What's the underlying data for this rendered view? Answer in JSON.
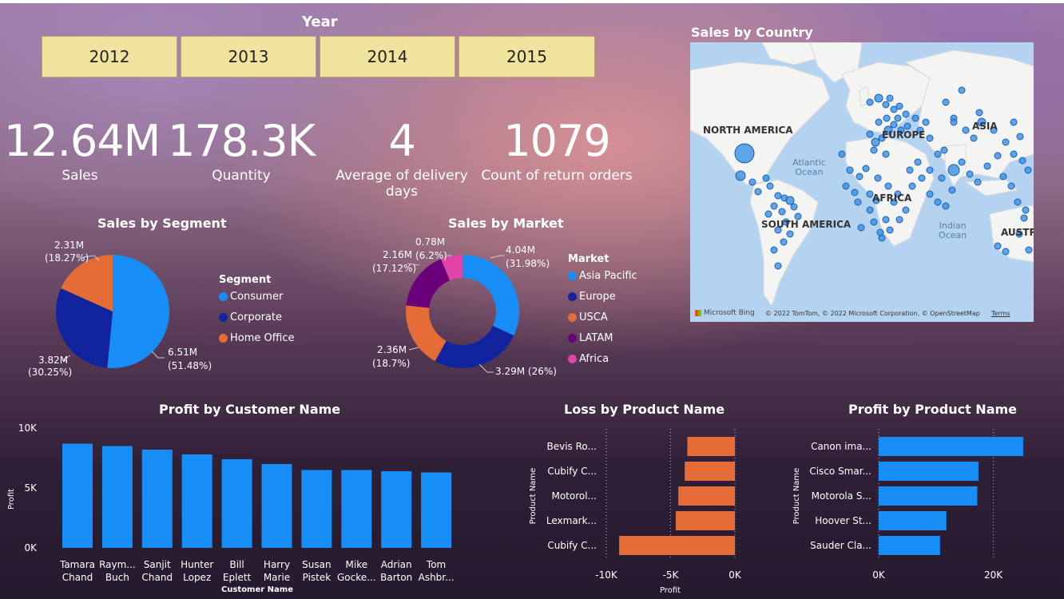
{
  "year_slicer": {
    "title": "Year",
    "options": [
      "2012",
      "2013",
      "2014",
      "2015"
    ]
  },
  "kpis": [
    {
      "value": "12.64M",
      "label": "Sales"
    },
    {
      "value": "178.3K",
      "label": "Quantity"
    },
    {
      "value": "4",
      "label": "Average of delivery days"
    },
    {
      "value": "1079",
      "label": "Count of return orders"
    }
  ],
  "map": {
    "title": "Sales by Country",
    "labels": {
      "north_america": "NORTH AMERICA",
      "europe": "EUROPE",
      "asia": "ASIA",
      "africa": "AFRICA",
      "south_america": "SOUTH AMERICA",
      "australia": "AUSTRA",
      "atlantic": "Atlantic\nOcean",
      "indian": "Indian\nOcean"
    },
    "logo": "Microsoft Bing",
    "copyright": "© 2022 TomTom, © 2022 Microsoft Corporation, © OpenStreetMap",
    "terms": "Terms"
  },
  "colors": {
    "blue": "#168ef5",
    "navy": "#12239e",
    "orange": "#e66c37",
    "purple": "#6b007b",
    "pink": "#e044a7",
    "slicer_bg": "#f0e39e"
  },
  "chart_data": [
    {
      "type": "pie",
      "title": "Sales by Segment",
      "legend_title": "Segment",
      "categories": [
        "Consumer",
        "Corporate",
        "Home Office"
      ],
      "values": [
        6.51,
        3.82,
        2.31
      ],
      "data_labels": [
        {
          "value": "6.51M",
          "pct": "(51.48%)"
        },
        {
          "value": "3.82M",
          "pct": "(30.25%)"
        },
        {
          "value": "2.31M",
          "pct": "(18.27%)"
        }
      ],
      "colors": [
        "#168ef5",
        "#12239e",
        "#e66c37"
      ],
      "legend_position": "right"
    },
    {
      "type": "donut",
      "title": "Sales by Market",
      "legend_title": "Market",
      "categories": [
        "Asia Pacific",
        "Europe",
        "USCA",
        "LATAM",
        "Africa"
      ],
      "values": [
        4.04,
        3.29,
        2.36,
        2.16,
        0.78
      ],
      "data_labels": [
        {
          "value": "4.04M",
          "pct": "(31.98%)"
        },
        {
          "value": "3.29M",
          "pct": "(26%)"
        },
        {
          "value": "2.36M",
          "pct": "(18.7%)"
        },
        {
          "value": "2.16M",
          "pct": "(17.12%)"
        },
        {
          "value": "0.78M",
          "pct": "(6.2%)"
        }
      ],
      "colors": [
        "#168ef5",
        "#12239e",
        "#e66c37",
        "#6b007b",
        "#e044a7"
      ],
      "legend_position": "right"
    },
    {
      "type": "bar",
      "title": "Profit by Customer Name",
      "xlabel": "Customer Name",
      "ylabel": "Profit",
      "categories": [
        [
          "Tamara",
          "Chand"
        ],
        [
          "Raym...",
          "Buch"
        ],
        [
          "Sanjit",
          "Chand"
        ],
        [
          "Hunter",
          "Lopez"
        ],
        [
          "Bill",
          "Eplett"
        ],
        [
          "Harry",
          "Marie"
        ],
        [
          "Susan",
          "Pistek"
        ],
        [
          "Mike",
          "Gocke..."
        ],
        [
          "Adrian",
          "Barton"
        ],
        [
          "Tom",
          "Ashbr..."
        ]
      ],
      "values": [
        8700,
        8500,
        8200,
        7800,
        7400,
        7000,
        6500,
        6500,
        6400,
        6300
      ],
      "ylim": [
        0,
        10000
      ],
      "yticks": [
        {
          "v": 0,
          "label": "0K"
        },
        {
          "v": 5000,
          "label": "5K"
        },
        {
          "v": 10000,
          "label": "10K"
        }
      ],
      "color": "#168ef5"
    },
    {
      "type": "bar",
      "orientation": "horizontal",
      "title": "Loss by Product Name",
      "xlabel": "Profit",
      "ylabel": "Product Name",
      "categories": [
        "Bevis Ro...",
        "Cubify C...",
        "Motorol...",
        "Lexmark...",
        "Cubify C..."
      ],
      "values": [
        -3700,
        -3900,
        -4400,
        -4600,
        -9000
      ],
      "xlim": [
        -10000,
        0
      ],
      "xticks": [
        {
          "v": -10000,
          "label": "-10K"
        },
        {
          "v": -5000,
          "label": "-5K"
        },
        {
          "v": 0,
          "label": "0K"
        }
      ],
      "color": "#e66c37"
    },
    {
      "type": "bar",
      "orientation": "horizontal",
      "title": "Profit by Product Name",
      "ylabel": "Product Name",
      "categories": [
        "Canon ima...",
        "Cisco Smar...",
        "Motorola S...",
        "Hoover St...",
        "Sauder Cla..."
      ],
      "values": [
        25200,
        17400,
        17200,
        11800,
        10700
      ],
      "xlim": [
        0,
        28000
      ],
      "xticks": [
        {
          "v": 0,
          "label": "0K"
        },
        {
          "v": 20000,
          "label": "20K"
        }
      ],
      "color": "#168ef5"
    }
  ]
}
